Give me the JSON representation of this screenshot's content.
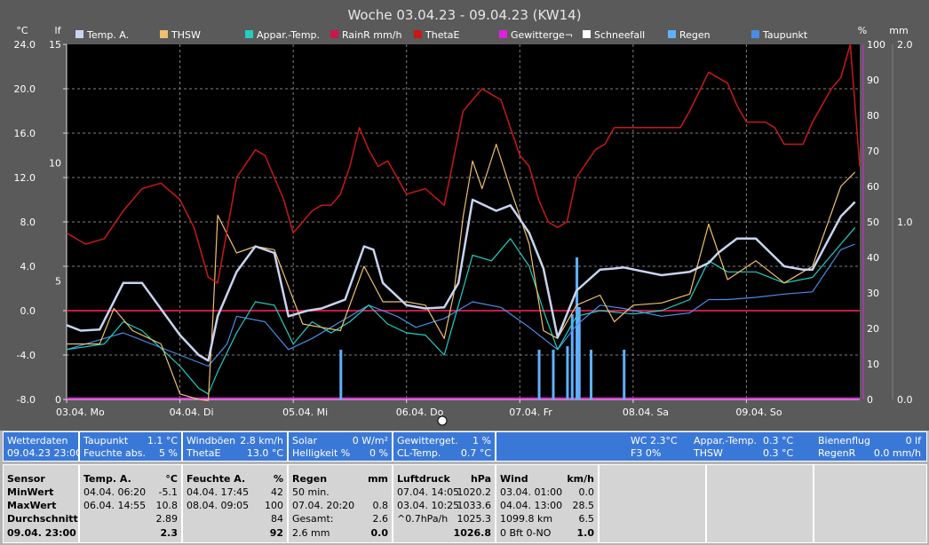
{
  "chart_data": {
    "type": "line",
    "title": "Woche 03.04.23 - 09.04.23 (KW14)",
    "x_categories": [
      "03.04. Mo",
      "04.04. Di",
      "05.04. Mi",
      "06.04. Do",
      "07.04. Fr",
      "08.04. Sa",
      "09.04. So"
    ],
    "x_range_hours": [
      0,
      168
    ],
    "axes": {
      "left_temp": {
        "unit": "°C",
        "min": -8.0,
        "max": 24.0,
        "ticks": [
          "24.0",
          "20.0",
          "16.0",
          "12.0",
          "8.0",
          "4.0",
          "0.0",
          "-4.0",
          "-8.0"
        ]
      },
      "left_lf": {
        "unit": "lf",
        "min": 0,
        "max": 15,
        "ticks": [
          "15",
          "10",
          "5",
          "0"
        ]
      },
      "right_pct": {
        "unit": "%",
        "min": 10,
        "max": 100,
        "ticks": [
          "100",
          "90",
          "80",
          "70",
          "60",
          "50",
          "40",
          "30",
          "20",
          "10",
          "0"
        ]
      },
      "right_mm": {
        "unit": "mm",
        "min": 0,
        "max": 2.0,
        "ticks": [
          "2.0",
          "1.0",
          "0.0"
        ]
      }
    },
    "grid": true,
    "legend": [
      "Temp. A.",
      "THSW",
      "Appar.-Temp.",
      "RainR mm/h",
      "ThetaE",
      "Gewitterge¬",
      "Schneefall",
      "Regen",
      "Taupunkt"
    ],
    "series": [
      {
        "name": "Temp. A.",
        "axis": "left_temp",
        "color": "#c8d4f0",
        "x": [
          0,
          3,
          7,
          12,
          16,
          24,
          28,
          30,
          32,
          36,
          40,
          44,
          47,
          51,
          54,
          59,
          63,
          65,
          67,
          72,
          76,
          80,
          83,
          86,
          91,
          94,
          98,
          101,
          104,
          108,
          113,
          116,
          118,
          126,
          132,
          136,
          138,
          142,
          146,
          152,
          156,
          158,
          164,
          167
        ],
        "values": [
          -1.3,
          -1.8,
          -1.7,
          2.5,
          2.5,
          -2.2,
          -4.0,
          -4.5,
          -0.5,
          3.5,
          5.8,
          5.2,
          -0.5,
          0.0,
          0.2,
          1.0,
          5.8,
          5.5,
          2.5,
          0.5,
          0.2,
          0.3,
          2.5,
          10.0,
          9.0,
          9.5,
          7.0,
          3.8,
          -2.4,
          1.8,
          3.7,
          3.8,
          3.9,
          3.2,
          3.5,
          4.3,
          5.2,
          6.5,
          6.5,
          4.0,
          3.7,
          3.7,
          8.5,
          9.8
        ]
      },
      {
        "name": "THSW",
        "axis": "left_temp",
        "color": "#f0c070",
        "x": [
          0,
          7,
          10,
          14,
          20,
          24,
          28,
          30,
          31,
          32,
          36,
          40,
          44,
          50,
          54,
          58,
          63,
          67,
          72,
          76,
          80,
          82,
          84,
          86,
          88,
          91,
          94,
          98,
          101,
          104,
          108,
          113,
          116,
          120,
          126,
          132,
          136,
          140,
          146,
          152,
          158,
          164,
          167
        ],
        "values": [
          -3.0,
          -3.0,
          0.2,
          -1.8,
          -3.0,
          -7.5,
          -8.0,
          -8.1,
          -0.5,
          8.6,
          5.2,
          5.8,
          5.5,
          -1.2,
          -1.5,
          -1.8,
          4.0,
          0.8,
          0.8,
          0.5,
          -2.5,
          1.5,
          8.5,
          13.5,
          11.0,
          15.0,
          11.0,
          6.0,
          -1.8,
          -2.5,
          0.5,
          1.4,
          -1.0,
          0.5,
          0.7,
          1.5,
          7.8,
          2.8,
          4.5,
          2.5,
          4.0,
          11.2,
          12.5
        ]
      },
      {
        "name": "Appar.-Temp.",
        "axis": "left_temp",
        "color": "#20d0c0",
        "x": [
          0,
          8,
          12,
          16,
          24,
          28,
          30,
          32,
          36,
          40,
          44,
          48,
          52,
          56,
          60,
          64,
          68,
          72,
          76,
          80,
          83,
          86,
          90,
          94,
          98,
          101,
          104,
          108,
          113,
          120,
          126,
          132,
          136,
          140,
          146,
          152,
          158,
          164,
          167
        ],
        "values": [
          -3.5,
          -3.0,
          -1.0,
          -1.8,
          -5.0,
          -7.0,
          -7.5,
          -5.5,
          -2.0,
          0.8,
          0.5,
          -3.0,
          -1.0,
          -2.0,
          -1.0,
          0.5,
          -1.2,
          -2.0,
          -2.2,
          -4.0,
          0.5,
          5.0,
          4.5,
          6.5,
          4.0,
          0.0,
          -3.5,
          -0.5,
          0.0,
          -0.3,
          0.0,
          1.0,
          4.5,
          3.5,
          3.5,
          2.5,
          3.0,
          6.0,
          7.5
        ]
      },
      {
        "name": "Taupunkt",
        "axis": "left_temp",
        "color": "#4a8ce6",
        "x": [
          0,
          12,
          18,
          24,
          30,
          34,
          36,
          42,
          47,
          52,
          56,
          60,
          64,
          70,
          74,
          80,
          86,
          92,
          98,
          104,
          108,
          113,
          118,
          126,
          132,
          136,
          140,
          146,
          152,
          158,
          164,
          167
        ],
        "values": [
          -3.5,
          -2.0,
          -3.0,
          -4.0,
          -5.0,
          -3.0,
          -0.5,
          -1.0,
          -3.5,
          -2.5,
          -1.5,
          -0.5,
          0.5,
          -0.5,
          -1.5,
          -0.7,
          0.8,
          0.3,
          -1.5,
          -3.5,
          -1.3,
          0.5,
          0.2,
          -0.5,
          -0.2,
          1.0,
          1.0,
          1.2,
          1.5,
          1.7,
          5.5,
          6.0
        ]
      },
      {
        "name": "ThetaE",
        "axis": "left_temp",
        "color": "#c81818",
        "x": [
          0,
          4,
          8,
          12,
          14,
          16,
          20,
          24,
          27,
          28,
          30,
          32,
          36,
          40,
          42,
          46,
          48,
          52,
          54,
          56,
          58,
          60,
          62,
          64,
          66,
          68,
          72,
          76,
          80,
          84,
          86,
          88,
          90,
          92,
          96,
          98,
          100,
          102,
          104,
          106,
          108,
          112,
          114,
          116,
          120,
          124,
          126,
          130,
          132,
          136,
          140,
          142,
          144,
          148,
          150,
          152,
          156,
          158,
          162,
          164,
          166,
          168
        ],
        "values": [
          7.0,
          6.0,
          6.5,
          9.0,
          10.0,
          11.0,
          11.5,
          10.0,
          7.5,
          6.0,
          3.0,
          2.5,
          12.0,
          14.5,
          14.0,
          10.0,
          7.0,
          9.0,
          9.5,
          9.5,
          10.5,
          13.0,
          16.5,
          14.5,
          13.0,
          13.5,
          10.5,
          11.0,
          9.5,
          18.0,
          19.0,
          20.0,
          19.5,
          19.0,
          14.0,
          13.0,
          10.0,
          8.0,
          7.5,
          8.0,
          12.0,
          14.5,
          15.0,
          16.5,
          16.5,
          16.5,
          16.5,
          16.5,
          18.0,
          21.5,
          20.5,
          18.5,
          17.0,
          17.0,
          16.5,
          15.0,
          15.0,
          17.0,
          20.0,
          21.0,
          24.0,
          13.0
        ]
      }
    ],
    "horizontal_lines": [
      {
        "name": "RainR mm/h",
        "axis": "left_temp",
        "color": "#c81848",
        "value": 0.0
      },
      {
        "name": "Gewitterge¬",
        "axis": "left_temp",
        "color": "#e020e0",
        "value": -7.9
      }
    ],
    "bars": {
      "name": "Regen",
      "axis": "right_mm",
      "color": "#60b0ff",
      "x": [
        58,
        100,
        103,
        106,
        107,
        108,
        108.5,
        111,
        118
      ],
      "values": [
        0.28,
        0.28,
        0.28,
        0.3,
        0.48,
        0.8,
        0.52,
        0.28,
        0.28
      ]
    },
    "colors": {
      "Temp. A.": "#c8d4f0",
      "THSW": "#f0c070",
      "Appar.-Temp.": "#20d0c0",
      "RainR mm/h": "#c81848",
      "ThetaE": "#c81818",
      "Gewitterge¬": "#e020e0",
      "Schneefall": "#ffffff",
      "Regen": "#60b0ff",
      "Taupunkt": "#4a8ce6"
    }
  },
  "panel": {
    "wetter": {
      "l1": "Wetterdaten",
      "l2": "09.04.23 23:00"
    },
    "taupunkt": {
      "label": "Taupunkt",
      "value": "1.1 °C",
      "label2": "Feuchte abs.",
      "value2": "5 %"
    },
    "windboeen": {
      "label": "Windböen",
      "value": "2.8 km/h",
      "label2": "ThetaE",
      "value2": "13.0 °C"
    },
    "solar": {
      "label": "Solar",
      "value": "0 W/m²",
      "label2": "Helligkeit %",
      "value2": "0 %"
    },
    "gewitter": {
      "label": "Gewitterget.",
      "value": "1 %",
      "label2": "CL-Temp.",
      "value2": "0.7 °C"
    },
    "wide": {
      "wc": "WC 2.3°C",
      "f3": "F3 0%",
      "app_label": "Appar.-Temp.",
      "app_value": "0.3 °C",
      "thsw_label": "THSW",
      "thsw_value": "0.3 °C",
      "biene_label": "Bienenflug",
      "biene_value": "0 lf",
      "regenr_label": "RegenR",
      "regenr_value": "0.0 mm/h"
    },
    "sensor": {
      "h": "Sensor",
      "r1": "MinWert",
      "r2": "MaxWert",
      "r3": "Durchschnitt",
      "r4": "09.04. 23:00"
    },
    "temp": {
      "h": "Temp. A.",
      "unit": "°C",
      "r1a": "04.04.  06:20",
      "r1b": "-5.1",
      "r2a": "06.04.  14:55",
      "r2b": "10.8",
      "r3b": "2.89",
      "r4b": "2.3"
    },
    "feuchte": {
      "h": "Feuchte A.",
      "unit": "%",
      "r1a": "04.04.  17:45",
      "r1b": "42",
      "r2a": "08.04.  09:05",
      "r2b": "100",
      "r3b": "84",
      "r4b": "92"
    },
    "regen": {
      "h": "Regen",
      "unit": "mm",
      "r1a": "50 min.",
      "r2a": "07.04.  20:20",
      "r2b": "0.8",
      "r3a": "Gesamt:",
      "r3b": "2.6",
      "r4a": "2.6 mm",
      "r4b": "0.0"
    },
    "luft": {
      "h": "Luftdruck",
      "unit": "hPa",
      "r1a": "07.04.  14:05",
      "r1b": "1020.2",
      "r2a": "03.04.  10:25",
      "r2b": "1033.6",
      "r3a": "^0.7hPa/h",
      "r3b": "1025.3",
      "r4b": "1026.8"
    },
    "wind": {
      "h": "Wind",
      "unit": "km/h",
      "r1a": "03.04.  01:00",
      "r1b": "0.0",
      "r2a": "04.04.  13:00",
      "r2b": "28.5",
      "r3a": "1099.8 km",
      "r3b": "6.5",
      "r4a": "0 Bft 0-NO",
      "r4b": "1.0"
    }
  }
}
